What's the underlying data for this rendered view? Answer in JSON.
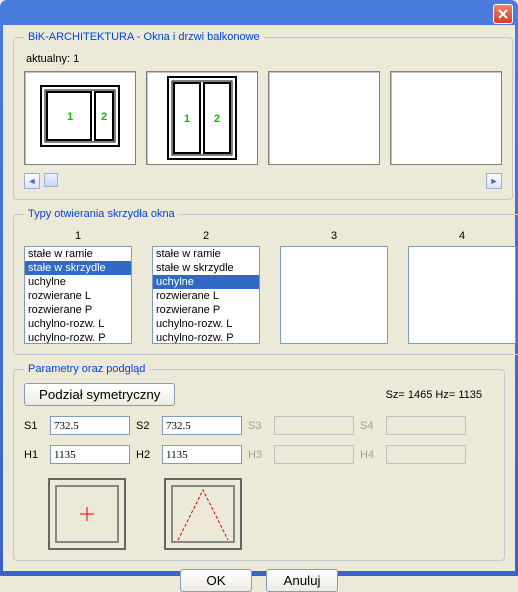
{
  "titlebar": {
    "close_title": "Close"
  },
  "group1": {
    "legend": "BiK-ARCHITEKTURA - Okna i drzwi balkonowe",
    "aktualny_label": "aktualny: 1"
  },
  "group2": {
    "legend": "Typy otwierania skrzydła okna",
    "cols": [
      "1",
      "2",
      "3",
      "4"
    ],
    "list1": [
      "stałe w ramie",
      "stałe w skrzydle",
      "uchylne",
      "rozwierane L",
      "rozwierane P",
      "uchylno-rozw. L",
      "uchylno-rozw. P"
    ],
    "list1_selected": 1,
    "list2": [
      "stałe w ramie",
      "stałe w skrzydle",
      "uchylne",
      "rozwierane L",
      "rozwierane P",
      "uchylno-rozw. L",
      "uchylno-rozw. P"
    ],
    "list2_selected": 2
  },
  "group3": {
    "legend": "Parametry oraz podgląd",
    "button_podzial": "Podział symetryczny",
    "sz_hz": "Sz= 1465    Hz= 1135",
    "S1_label": "S1",
    "S1_value": "732.5",
    "S2_label": "S2",
    "S2_value": "732.5",
    "S3_label": "S3",
    "S4_label": "S4",
    "H1_label": "H1",
    "H1_value": "1135",
    "H2_label": "H2",
    "H2_value": "1135",
    "H3_label": "H3",
    "H4_label": "H4"
  },
  "buttons": {
    "ok": "OK",
    "cancel": "Anuluj"
  }
}
